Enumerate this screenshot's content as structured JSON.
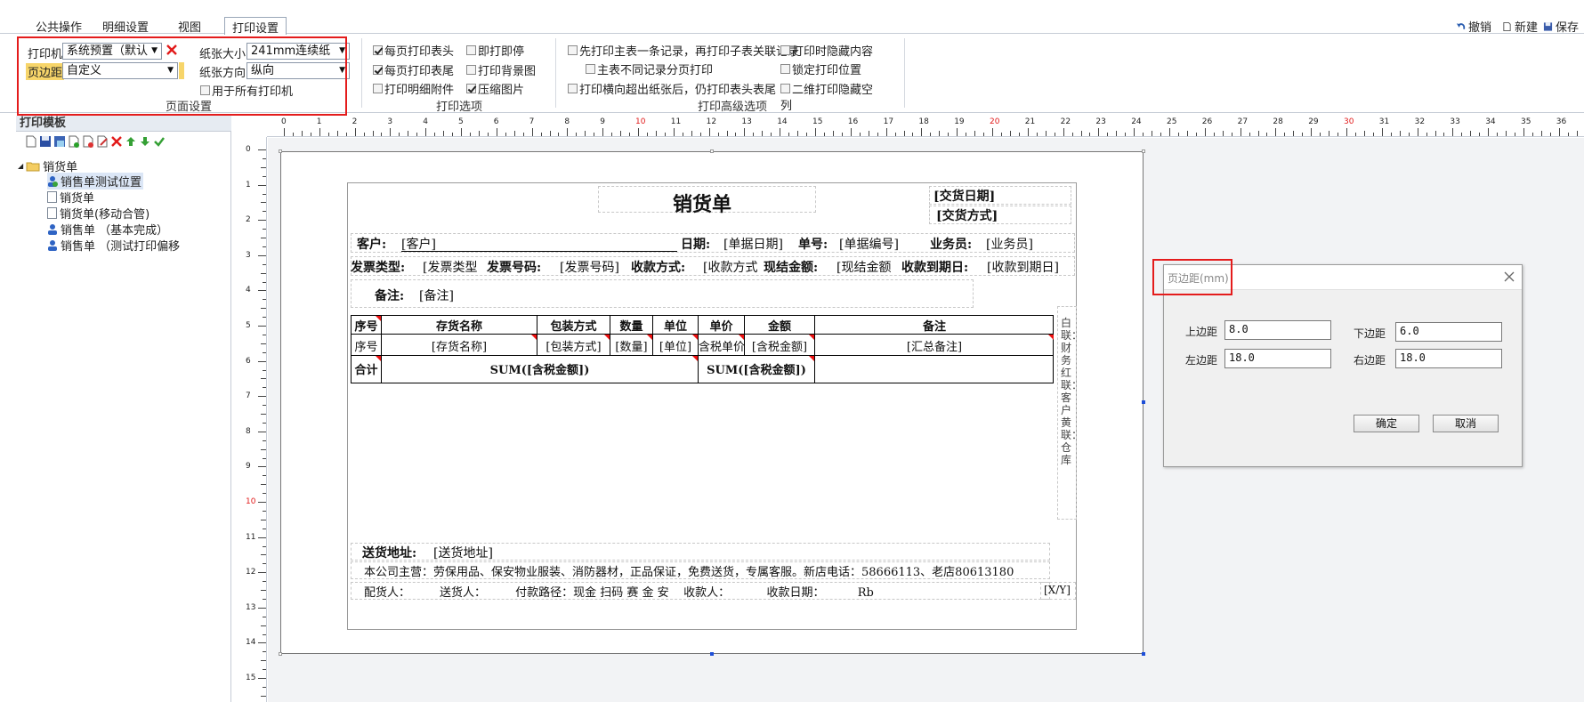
{
  "tabs": [
    "公共操作",
    "明细设置",
    "视图",
    "打印设置"
  ],
  "active_tab": "打印设置",
  "toolbar_right": {
    "undo": "撤销",
    "new": "新建",
    "save": "保存"
  },
  "page_setup": {
    "printer_label": "打印机",
    "printer_value": "系统预置（默认",
    "margin_label": "页边距",
    "margin_value": "自定义",
    "paper_size_label": "纸张大小",
    "paper_size_value": "241mm连续纸",
    "orientation_label": "纸张方向",
    "orientation_value": "纵向",
    "all_printers": "用于所有打印机",
    "group_label": "页面设置"
  },
  "print_options": {
    "items": [
      {
        "label": "每页打印表头",
        "checked": true
      },
      {
        "label": "即打即停",
        "checked": false
      },
      {
        "label": "每页打印表尾",
        "checked": true
      },
      {
        "label": "打印背景图",
        "checked": false
      },
      {
        "label": "打印明细附件",
        "checked": false
      },
      {
        "label": "压缩图片",
        "checked": true
      }
    ],
    "group_label": "打印选项"
  },
  "advanced_options": {
    "items": [
      {
        "label": "先打印主表一条记录，再打印子表关联记录",
        "checked": false
      },
      {
        "label": "主表不同记录分页打印",
        "checked": false
      },
      {
        "label": "打印横向超出纸张后，仍打印表头表尾",
        "checked": false
      },
      {
        "label": "打印时隐藏内容",
        "checked": false
      },
      {
        "label": "锁定打印位置",
        "checked": false
      },
      {
        "label": "二维打印隐藏空",
        "checked": false
      },
      {
        "label": "列",
        "checked": false
      }
    ],
    "group_label": "打印高级选项"
  },
  "template_panel": {
    "title": "打印模板",
    "root": "销货单",
    "items": [
      "销售单测试位置",
      "销货单",
      "销货单(移动合管)",
      "销售单 （基本完成）",
      "销售单 （测试打印偏移"
    ],
    "selected": "销售单测试位置"
  },
  "ruler": {
    "h": [
      "0",
      "1",
      "2",
      "3",
      "4",
      "5",
      "6",
      "7",
      "8",
      "9",
      "10",
      "11",
      "12",
      "13",
      "14",
      "15",
      "16",
      "17",
      "18",
      "19",
      "20",
      "21",
      "22",
      "23",
      "24",
      "25",
      "26",
      "27",
      "28",
      "29",
      "30",
      "31",
      "32",
      "33",
      "34",
      "35",
      "36"
    ],
    "v": [
      "0",
      "1",
      "2",
      "3",
      "4",
      "5",
      "6",
      "7",
      "8",
      "9",
      "10",
      "11",
      "12",
      "13",
      "14",
      "15"
    ],
    "accent": "#e21a1a"
  },
  "form": {
    "title": "销货单",
    "delivery_date": "[交货日期]",
    "delivery_method": "[交货方式]",
    "customer_label": "客户:",
    "customer_value": "[客户]",
    "date_label": "日期:",
    "date_value": "[单据日期]",
    "no_label": "单号:",
    "no_value": "[单据编号]",
    "sales_label": "业务员:",
    "sales_value": "[业务员]",
    "invoice_type_label": "发票类型:",
    "invoice_type_value": "[发票类型",
    "invoice_no_label": "发票号码:",
    "invoice_no_value": "[发票号码]",
    "pay_method_label": "收款方式:",
    "pay_method_value": "[收款方式",
    "cash_label": "现结金额:",
    "cash_value": "[现结金额",
    "due_label": "收款到期日:",
    "due_value": "[收款到期日]",
    "remark_label": "备注:",
    "remark_value": "[备注]",
    "table_headers": [
      "序号",
      "存货名称",
      "包装方式",
      "数量",
      "单位",
      "单价",
      "金额",
      "备注"
    ],
    "table_row": [
      "序号",
      "[存货名称]",
      "[包装方式]",
      "[数量]",
      "[单位]",
      "含税单价",
      "[含税金额]",
      "[汇总备注]"
    ],
    "total_row": [
      "合计",
      "SUM([含税金额])",
      "SUM([含税金额])"
    ],
    "side_text": "白联：财务  红联：客户  黄联：仓库",
    "address_label": "送货地址:",
    "address_value": "[送货地址]",
    "company_text": "本公司主营：劳保用品、保安物业服装、消防器材，正品保证，免费送货，专属客服。新店电话：58666113、老店80613180",
    "footer_text": "配货人：        送货人：        付款路径：现金 扫码 赛 金 安    收款人：          收款日期：         Rb",
    "page_no": "[X/Y]"
  },
  "margin_dialog": {
    "title": "页边距(mm)",
    "top_label": "上边距",
    "top_value": "8.0",
    "bottom_label": "下边距",
    "bottom_value": "6.0",
    "left_label": "左边距",
    "left_value": "18.0",
    "right_label": "右边距",
    "right_value": "18.0",
    "ok": "确定",
    "cancel": "取消"
  },
  "colors": {
    "highlight_red": "#e41c1c",
    "margin_label_bg": "#f7d56a",
    "ruler_red": "#e21a1a"
  }
}
